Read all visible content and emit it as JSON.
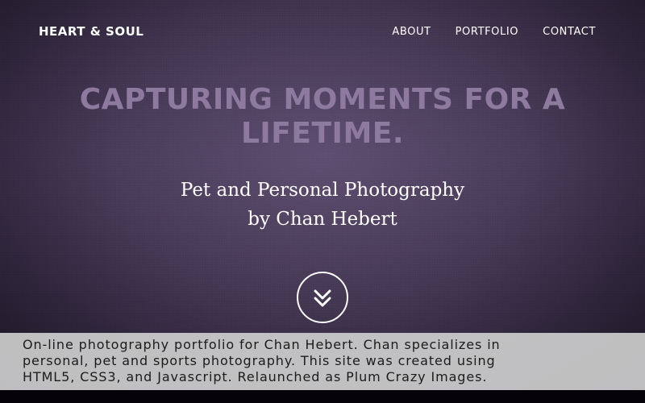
{
  "header": {
    "brand": "HEART & SOUL",
    "nav": [
      "ABOUT",
      "PORTFOLIO",
      "CONTACT"
    ]
  },
  "hero": {
    "headline_lines": [
      "CAPTURING MOMENTS FOR A",
      "LIFETIME."
    ],
    "subtitle_lines": [
      "Pet and Personal Photography",
      "by Chan Hebert"
    ],
    "scroll_icon": "double-chevron-down-icon"
  },
  "caption": {
    "lines": [
      "On-line photography portfolio for Chan Hebert. Chan specializes in",
      "personal, pet and sports photography. This site was created using",
      "HTML5, CSS3, and Javascript. Relaunched as Plum Crazy Images."
    ]
  },
  "colors": {
    "background": "#4a3d5b",
    "headline": "#8e7a9f",
    "text": "#ffffff",
    "caption_bg": "#cdcdcd"
  }
}
